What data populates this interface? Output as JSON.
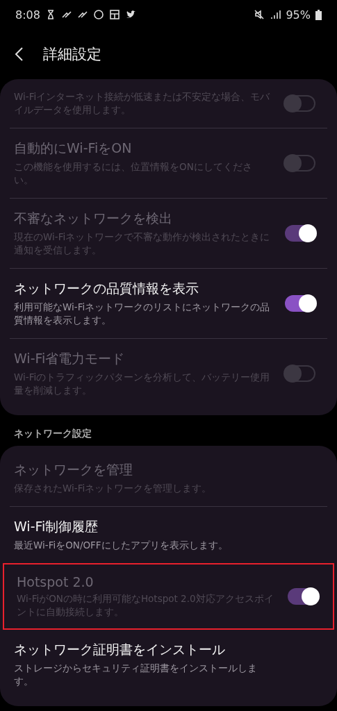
{
  "status_bar": {
    "time": "8:08",
    "battery": "95%"
  },
  "header": {
    "title": "詳細設定"
  },
  "groups": [
    {
      "items": [
        {
          "kind": "toggle",
          "description": "Wi-Fiインターネット接続が低速または不安定な場合、モバイルデータを使用します。",
          "disabled": true,
          "on": false,
          "highlighted": false
        },
        {
          "kind": "toggle",
          "title": "自動的にWi-FiをON",
          "description": "この機能を使用するには、位置情報をONにしてください。",
          "disabled": true,
          "on": false,
          "highlighted": false
        },
        {
          "kind": "toggle",
          "title": "不審なネットワークを検出",
          "description": "現在のWi-Fiネットワークで不審な動作が検出されたときに通知を受信します。",
          "disabled": true,
          "on": true,
          "highlighted": false
        },
        {
          "kind": "toggle",
          "title": "ネットワークの品質情報を表示",
          "description": "利用可能なWi-Fiネットワークのリストにネットワークの品質情報を表示します。",
          "disabled": false,
          "on": true,
          "highlighted": false
        },
        {
          "kind": "toggle",
          "title": "Wi-Fi省電力モード",
          "description": "Wi-Fiのトラフィックパターンを分析して、バッテリー使用量を削減します。",
          "disabled": true,
          "on": false,
          "highlighted": false
        }
      ]
    },
    {
      "heading": "ネットワーク設定",
      "items": [
        {
          "kind": "link",
          "title": "ネットワークを管理",
          "description": "保存されたWi-Fiネットワークを管理します。",
          "disabled": true,
          "highlighted": false
        },
        {
          "kind": "link",
          "title": "Wi-Fi制御履歴",
          "description": "最近Wi-FiをON/OFFにしたアプリを表示します。",
          "disabled": false,
          "highlighted": false
        },
        {
          "kind": "toggle",
          "title": "Hotspot 2.0",
          "description": "Wi-FiがONの時に利用可能なHotspot 2.0対応アクセスポイントに自動接続します。",
          "disabled": true,
          "on": true,
          "highlighted": true
        },
        {
          "kind": "link",
          "title": "ネットワーク証明書をインストール",
          "description": "ストレージからセキュリティ証明書をインストールします。",
          "disabled": false,
          "highlighted": false
        }
      ]
    }
  ]
}
